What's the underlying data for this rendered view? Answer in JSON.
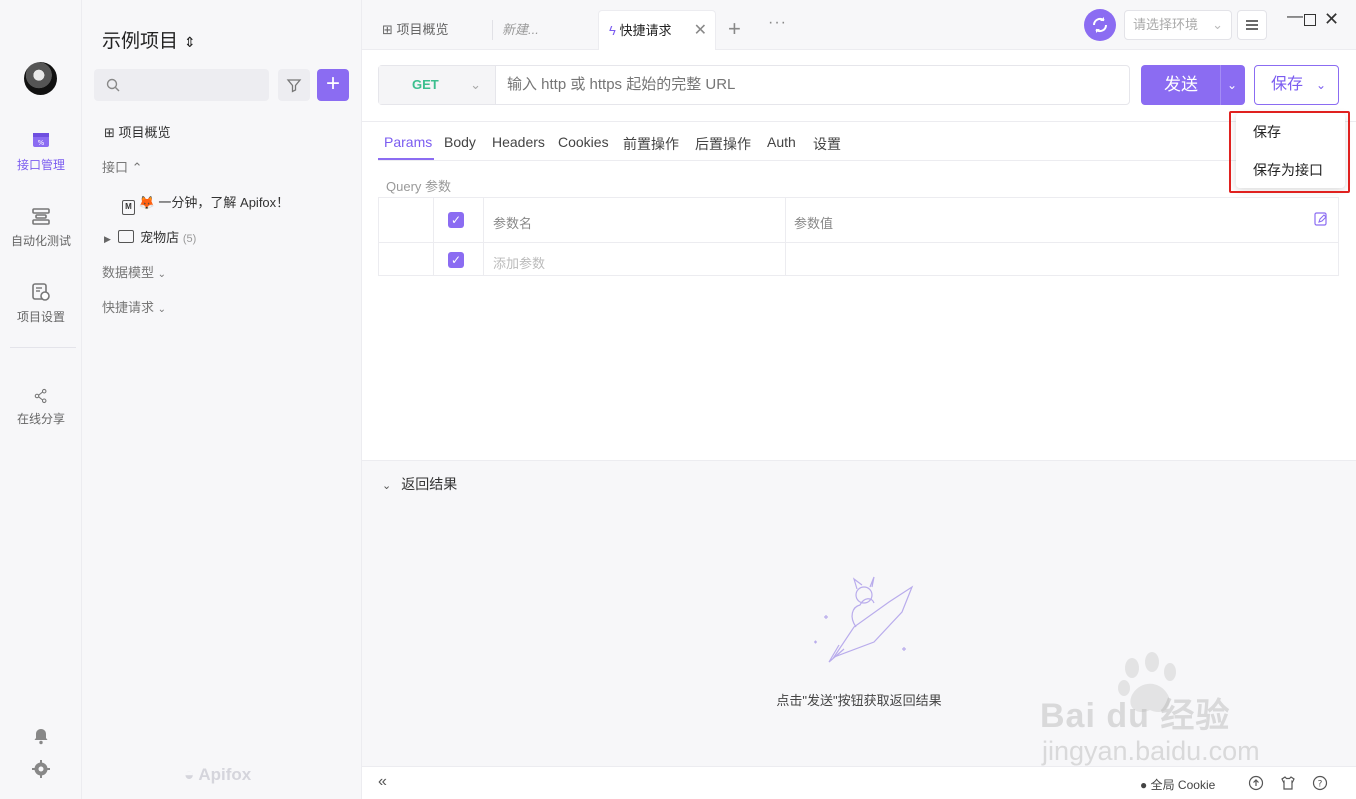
{
  "leftnav": {
    "items": [
      {
        "label": "接口管理",
        "icon": "api-management-icon"
      },
      {
        "label": "自动化测试",
        "icon": "automation-test-icon"
      },
      {
        "label": "项目设置",
        "icon": "project-settings-icon"
      },
      {
        "label": "在线分享",
        "icon": "share-icon"
      }
    ],
    "accent": "#7b5cf0"
  },
  "sidebar": {
    "project_title": "示例项目",
    "switch_glyph": "⌃⌄",
    "tree": {
      "overview": "项目概览",
      "interfaces": "接口",
      "intro_doc": "🦊 一分钟，了解 Apifox！",
      "folder_name": "宠物店",
      "folder_count": "(5)",
      "data_models": "数据模型",
      "quick_requests": "快捷请求"
    },
    "brand": "Apifox"
  },
  "tabs": [
    {
      "label": "项目概览"
    },
    {
      "label": "新建..."
    },
    {
      "label": "快捷请求"
    }
  ],
  "env": {
    "placeholder": "请选择环境"
  },
  "request": {
    "method": "GET",
    "url_placeholder": "输入 http 或 https 起始的完整 URL",
    "send_label": "发送",
    "save_label": "保存"
  },
  "param_tabs": [
    "Params",
    "Body",
    "Headers",
    "Cookies",
    "前置操作",
    "后置操作",
    "Auth",
    "设置"
  ],
  "query": {
    "label": "Query 参数",
    "col_name": "参数名",
    "col_value": "参数值",
    "add_placeholder": "添加参数"
  },
  "response": {
    "title": "返回结果",
    "hint": "点击\"发送\"按钮获取返回结果"
  },
  "status": {
    "cookie_label": "全局 Cookie"
  },
  "dropdown": {
    "options": [
      "保存",
      "保存为接口"
    ]
  },
  "watermark": {
    "line1": "Bai du 经验",
    "line2": "jingyan.baidu.com"
  }
}
